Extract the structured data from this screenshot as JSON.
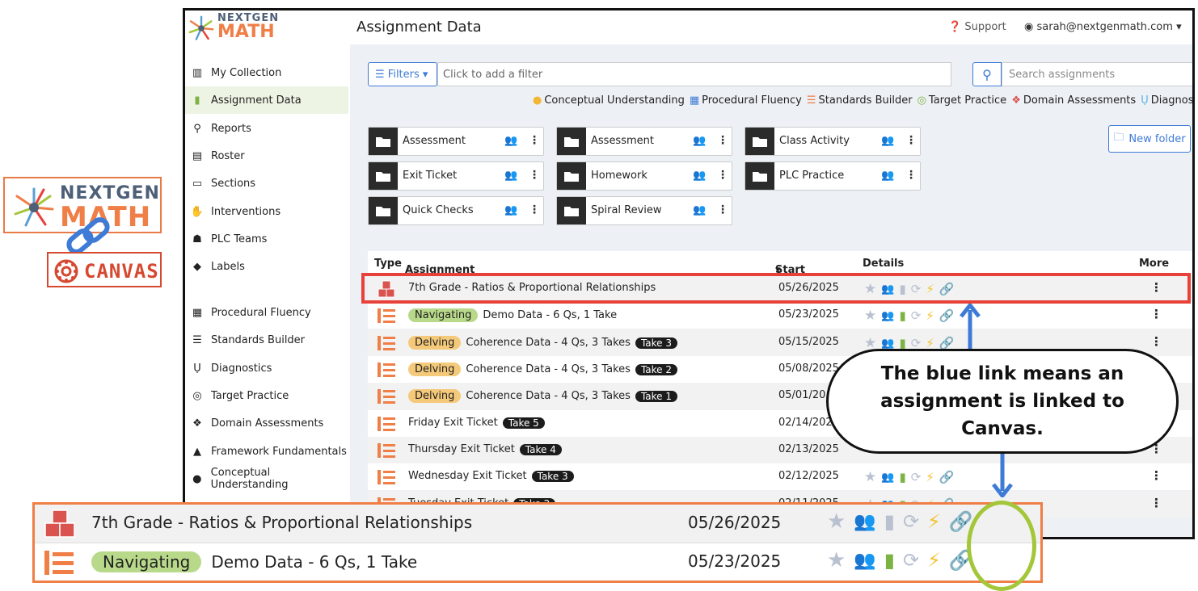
{
  "brand": {
    "line1": "NEXTGEN",
    "line2": "MATH",
    "canvas": "CANVAS"
  },
  "topbar": {
    "title": "Assignment Data",
    "support": "Support",
    "user": "sarah@nextgenmath.com"
  },
  "sidebar": {
    "items": [
      {
        "label": "My Collection",
        "icon": "books-icon"
      },
      {
        "label": "Assignment Data",
        "icon": "bar-chart-icon"
      },
      {
        "label": "Reports",
        "icon": "magnify-icon"
      },
      {
        "label": "Roster",
        "icon": "roster-icon"
      },
      {
        "label": "Sections",
        "icon": "sections-icon"
      },
      {
        "label": "Interventions",
        "icon": "hand-icon"
      },
      {
        "label": "PLC Teams",
        "icon": "team-icon"
      },
      {
        "label": "Labels",
        "icon": "tag-icon"
      },
      {
        "label": "Procedural Fluency",
        "icon": "grid-icon"
      },
      {
        "label": "Standards Builder",
        "icon": "list-icon"
      },
      {
        "label": "Diagnostics",
        "icon": "stethoscope-icon"
      },
      {
        "label": "Target Practice",
        "icon": "target-icon"
      },
      {
        "label": "Domain Assessments",
        "icon": "cubes-icon"
      },
      {
        "label": "Framework Fundamentals",
        "icon": "shapes-icon"
      },
      {
        "label": "Conceptual Understanding",
        "icon": "brain-icon"
      }
    ]
  },
  "toolbar": {
    "filters": "Filters",
    "filter_placeholder": "Click to add a filter",
    "search_placeholder": "Search assignments",
    "new_folder": "New folder"
  },
  "legend": [
    "Conceptual Understanding",
    "Procedural Fluency",
    "Standards Builder",
    "Target Practice",
    "Domain Assessments",
    "Diagnostics"
  ],
  "folders": [
    {
      "name": "Assessment"
    },
    {
      "name": "Assessment"
    },
    {
      "name": "Class Activity"
    },
    {
      "name": "Exit Ticket"
    },
    {
      "name": "Homework"
    },
    {
      "name": "PLC Practice"
    },
    {
      "name": "Quick Checks"
    },
    {
      "name": "Spiral Review"
    }
  ],
  "table": {
    "headers": {
      "type": "Type",
      "title": "Assignment Title",
      "start": "Start Date",
      "details": "Details",
      "more": "More"
    },
    "rows": [
      {
        "title": "7th Grade - Ratios & Proportional Relationships",
        "date": "05/26/2025",
        "badge": "",
        "take": ""
      },
      {
        "title": "Demo Data - 6 Qs, 1 Take",
        "date": "05/23/2025",
        "badge": "Navigating",
        "take": ""
      },
      {
        "title": "Coherence Data - 4 Qs, 3 Takes",
        "date": "05/15/2025",
        "badge": "Delving",
        "take": "Take 3"
      },
      {
        "title": "Coherence Data - 4 Qs, 3 Takes",
        "date": "05/08/2025",
        "badge": "Delving",
        "take": "Take 2"
      },
      {
        "title": "Coherence Data - 4 Qs, 3 Takes",
        "date": "05/01/20",
        "badge": "Delving",
        "take": "Take 1"
      },
      {
        "title": "Friday Exit Ticket",
        "date": "02/14/202",
        "badge": "",
        "take": "Take 5"
      },
      {
        "title": "Thursday Exit Ticket",
        "date": "02/13/2025",
        "badge": "",
        "take": "Take 4"
      },
      {
        "title": "Wednesday Exit Ticket",
        "date": "02/12/2025",
        "badge": "",
        "take": "Take 3"
      },
      {
        "title": "Tuesday Exit Ticket",
        "date": "02/11/2025",
        "badge": "",
        "take": "Take 2"
      }
    ]
  },
  "callout": "The blue link means an assignment is linked to Canvas.",
  "zoom": {
    "rows": [
      {
        "title": "7th Grade - Ratios & Proportional Relationships",
        "date": "05/26/2025",
        "badge": ""
      },
      {
        "title": "Demo Data - 6 Qs, 1 Take",
        "date": "05/23/2025",
        "badge": "Navigating"
      }
    ]
  },
  "colors": {
    "accent": "#3e7bd6",
    "orange": "#ef7e47",
    "red": "#e8413a",
    "green": "#a4c639",
    "navy": "#4e5f78"
  }
}
